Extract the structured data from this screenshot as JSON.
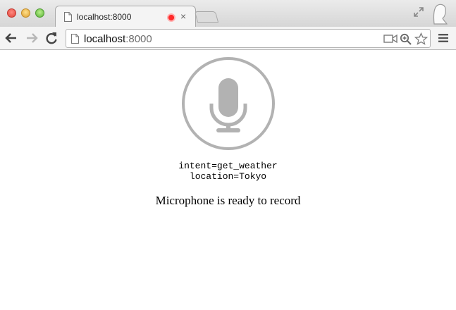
{
  "browser": {
    "tab": {
      "title": "localhost:8000",
      "close_glyph": "×",
      "recording": true
    },
    "address": {
      "host": "localhost",
      "port": ":8000"
    },
    "icons": [
      "page-icon",
      "record-icon",
      "close-icon",
      "fullscreen-icon",
      "profile-icon",
      "back-icon",
      "forward-icon",
      "reload-icon",
      "camera-icon",
      "zoom-icon",
      "star-icon",
      "menu-icon"
    ]
  },
  "page": {
    "mic": {
      "icon": "microphone-icon",
      "color": "#b2b2b2"
    },
    "result_lines": [
      "intent=get_weather",
      "location=Tokyo"
    ],
    "status": "Microphone is ready to record"
  }
}
